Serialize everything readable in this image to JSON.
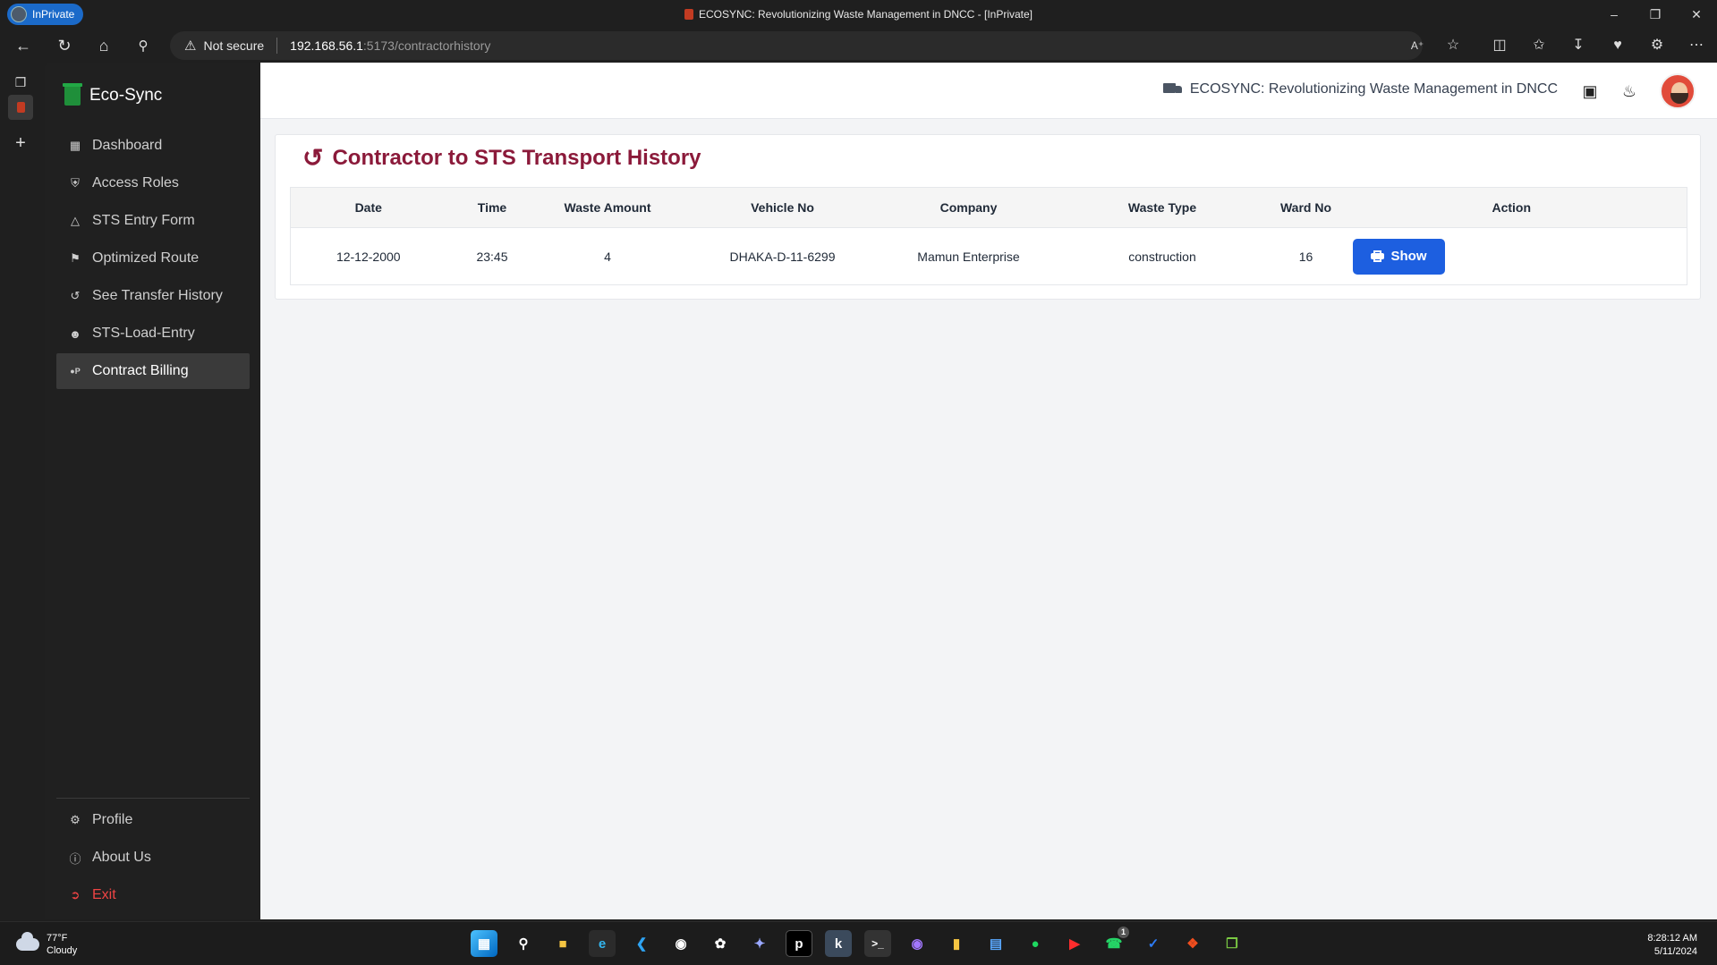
{
  "browser": {
    "inprivate_label": "InPrivate",
    "window_title": "ECOSYNC: Revolutionizing Waste Management in DNCC - [InPrivate]",
    "security_label": "Not secure",
    "url_host": "192.168.56.1",
    "url_path": ":5173/contractorhistory"
  },
  "sidebar": {
    "brand": "Eco-Sync",
    "items": [
      {
        "label": "Dashboard",
        "icon": "grid-icon"
      },
      {
        "label": "Access Roles",
        "icon": "shield-icon"
      },
      {
        "label": "STS Entry Form",
        "icon": "cube-icon"
      },
      {
        "label": "Optimized Route",
        "icon": "map-icon"
      },
      {
        "label": "See Transfer History",
        "icon": "history-icon"
      },
      {
        "label": "STS-Load-Entry",
        "icon": "users-icon"
      },
      {
        "label": "Contract Billing",
        "icon": "pay-icon",
        "active": true
      }
    ],
    "bottom_items": [
      {
        "label": "Profile",
        "icon": "gear-icon"
      },
      {
        "label": "About Us",
        "icon": "help-icon"
      },
      {
        "label": "Exit",
        "icon": "logout-icon"
      }
    ]
  },
  "header": {
    "site_title": "ECOSYNC: Revolutionizing Waste Management in DNCC"
  },
  "page": {
    "title": "Contractor to STS Transport History",
    "columns": [
      "Date",
      "Time",
      "Waste Amount",
      "Vehicle No",
      "Company",
      "Waste Type",
      "Ward No",
      "Action"
    ],
    "rows": [
      {
        "date": "12-12-2000",
        "time": "23:45",
        "waste_amount": "4",
        "vehicle_no": "DHAKA-D-11-6299",
        "company": "Mamun Enterprise",
        "waste_type": "construction",
        "ward_no": "16",
        "action_label": "Show"
      }
    ]
  },
  "taskbar": {
    "temperature": "77°F",
    "condition": "Cloudy",
    "time": "8:28:12 AM",
    "date": "5/11/2024",
    "whatsapp_badge": "1"
  },
  "colors": {
    "accent": "#8b1a3a",
    "primary_button": "#1d5fe0",
    "exit": "#ef4444",
    "brand_green": "#1f8f3a"
  }
}
